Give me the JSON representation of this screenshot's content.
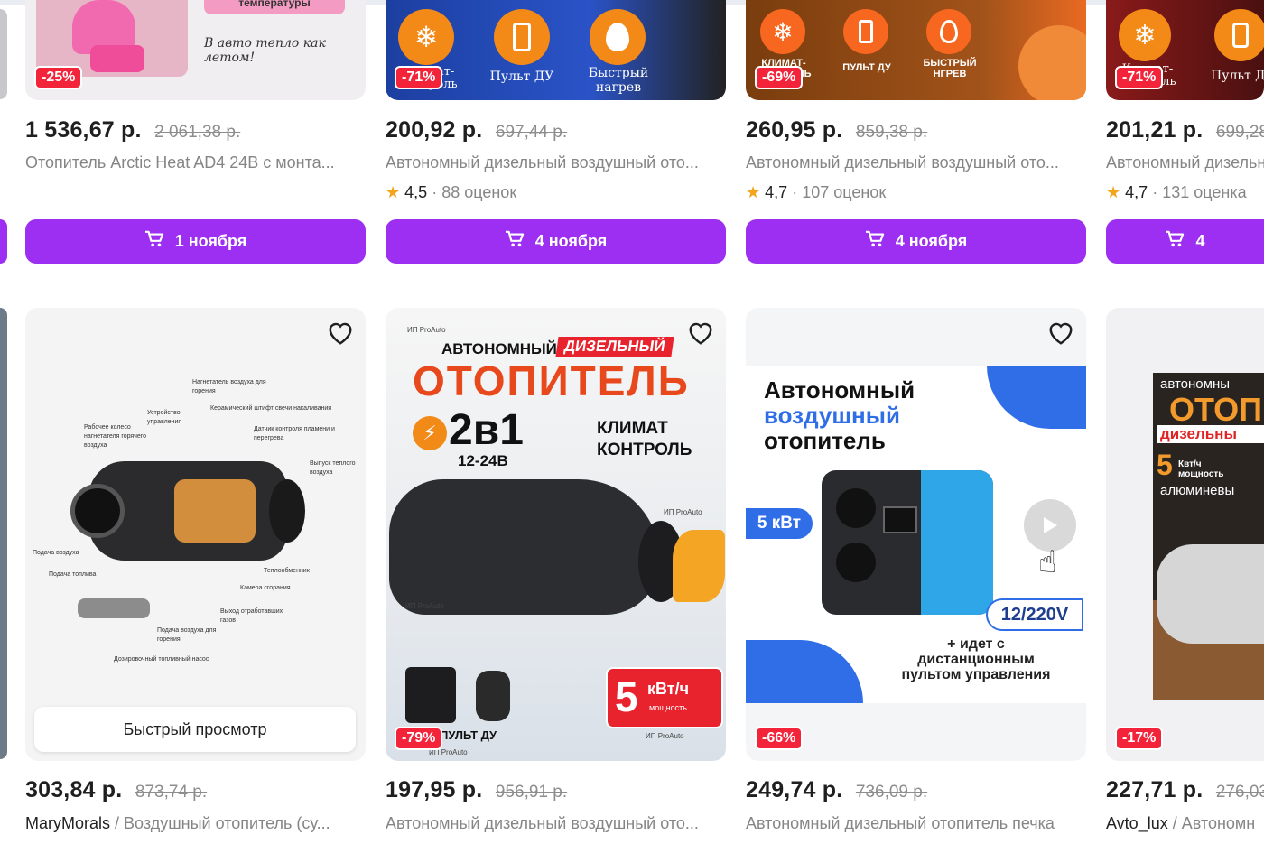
{
  "row1": [
    {
      "price": "1 536,67 р.",
      "old_price": "2 061,38 р.",
      "discount": "-25%",
      "title": "Отопитель Arctic Heat AD4 24В с монта...",
      "delivery": "1 ноября",
      "thumb_texts": [
        "температуры",
        "В авто тепло как летом!"
      ]
    },
    {
      "price": "200,92 р.",
      "old_price": "697,44 р.",
      "discount": "-71%",
      "title": "Автономный дизельный воздушный ото...",
      "rating": "4,5",
      "reviews": "88 оценок",
      "delivery": "4 ноября",
      "thumb_texts": [
        "Климат-\nконтроль",
        "Пульт ДУ",
        "Быстрый\nнагрев"
      ]
    },
    {
      "price": "260,95 р.",
      "old_price": "859,38 р.",
      "discount": "-69%",
      "title": "Автономный дизельный воздушный ото...",
      "rating": "4,7",
      "reviews": "107 оценок",
      "delivery": "4 ноября",
      "thumb_texts": [
        "КЛИМАТ-\nКОНТРОЛЬ",
        "ПУЛЬТ ДУ",
        "БЫСТРЫЙ\nНГРЕВ"
      ]
    },
    {
      "price": "201,21 р.",
      "old_price": "699,28",
      "discount": "-71%",
      "title": "Автономный дизельн",
      "rating": "4,7",
      "reviews": "131 оценка",
      "delivery": "4",
      "thumb_texts": [
        "Климат-\nконтроль",
        "Пульт ДУ"
      ]
    }
  ],
  "row2": [
    {
      "price": "303,84 р.",
      "old_price": "873,74 р.",
      "seller": "MaryMorals",
      "title": "Воздушный отопитель (су...",
      "quick_view": "Быстрый просмотр",
      "thumb_texts": [
        "Нагнетатель воздуха для горения",
        "Устройство управления",
        "Керамический штифт свечи накаливания",
        "Рабочее колесо нагнетателя горячего воздуха",
        "Датчик контроля пламени и перегрева",
        "Выпуск теплого воздуха",
        "Подача воздуха",
        "Подача топлива",
        "Теплообменник",
        "Камера сгорания",
        "Выход отработавших газов",
        "Подача воздуха для горения",
        "Дозировочный топливный насос"
      ]
    },
    {
      "price": "197,95 р.",
      "old_price": "956,91 р.",
      "discount": "-79%",
      "title": "Автономный дизельный воздушный ото...",
      "thumb_texts": [
        "ИП ProAuto",
        "АВТОНОМНЫЙ",
        "ДИЗЕЛЬНЫЙ",
        "ОТОПИТЕЛЬ",
        "2в1",
        "12-24В",
        "КЛИМАТ КОНТРОЛЬ",
        "ИП ProAuto",
        "ИП ProAuto",
        "5",
        "кВт/ч",
        "мощность",
        "ПУЛЬТ ДУ",
        "ИП ProAuto",
        "ИП ProAuto"
      ]
    },
    {
      "price": "249,74 р.",
      "old_price": "736,09 р.",
      "discount": "-66%",
      "title": "Автономный дизельный отопитель печка",
      "thumb_texts": [
        "Автономный",
        "воздушный",
        "отопитель",
        "5 кВт",
        "12/220V",
        "+ идет с\nдистанционным\nпультом управления"
      ]
    },
    {
      "price": "227,71 р.",
      "old_price": "276,03",
      "discount": "-17%",
      "seller": "Avto_lux",
      "title": "Автономн",
      "thumb_texts": [
        "автономны",
        "ОТОП",
        "дизельны",
        "5",
        "Квт/ч\nмощность",
        "алюминевы"
      ]
    }
  ],
  "colors": {
    "accent": "#9c2ff2",
    "discount": "#f3233a",
    "star": "#f2a41a"
  }
}
